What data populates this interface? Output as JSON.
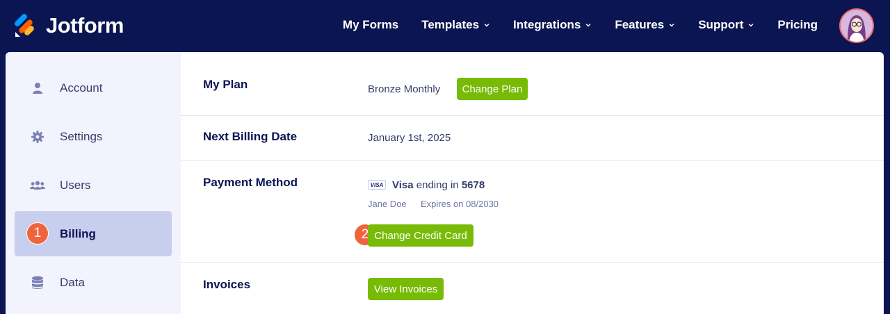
{
  "brand": {
    "name": "Jotform"
  },
  "nav": {
    "items": [
      {
        "label": "My Forms",
        "has_dropdown": false
      },
      {
        "label": "Templates",
        "has_dropdown": true
      },
      {
        "label": "Integrations",
        "has_dropdown": true
      },
      {
        "label": "Features",
        "has_dropdown": true
      },
      {
        "label": "Support",
        "has_dropdown": true
      },
      {
        "label": "Pricing",
        "has_dropdown": false
      }
    ]
  },
  "sidebar": {
    "items": [
      {
        "label": "Account",
        "icon": "user-icon"
      },
      {
        "label": "Settings",
        "icon": "gear-icon"
      },
      {
        "label": "Users",
        "icon": "users-icon"
      },
      {
        "label": "Billing",
        "icon": "step-1-badge",
        "active": true,
        "step": "1"
      },
      {
        "label": "Data",
        "icon": "database-icon"
      }
    ]
  },
  "billing": {
    "plan": {
      "label": "My Plan",
      "value": "Bronze Monthly",
      "button": "Change Plan"
    },
    "next_billing": {
      "label": "Next Billing Date",
      "value": "January 1st, 2025"
    },
    "payment": {
      "label": "Payment Method",
      "card_badge": "VISA",
      "card_brand": "Visa",
      "ending_text": "ending in",
      "last4": "5678",
      "holder": "Jane Doe",
      "expires": "Expires on 08/2030",
      "step": "2",
      "button": "Change Credit Card"
    },
    "invoices": {
      "label": "Invoices",
      "button": "View Invoices"
    }
  },
  "colors": {
    "nav_bg": "#0a1551",
    "accent_green": "#78bb07",
    "step_orange": "#f0643c",
    "sidebar_bg": "#f3f3fe",
    "sidebar_active": "#c8ceed"
  }
}
